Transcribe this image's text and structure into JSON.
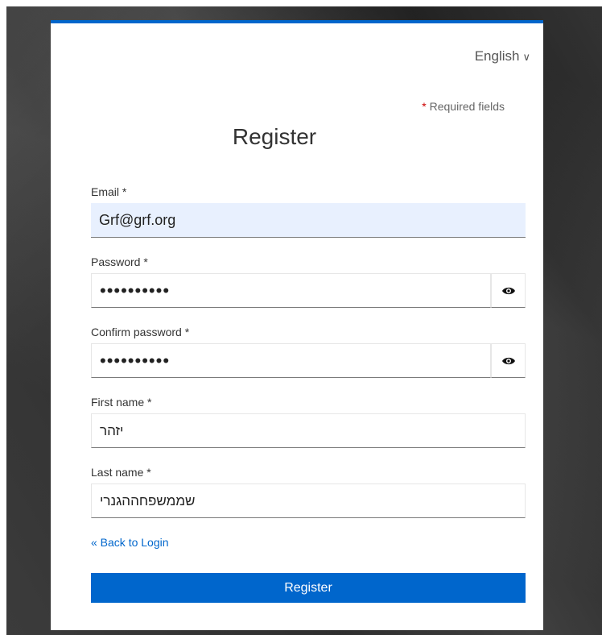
{
  "language": {
    "label": "English",
    "chevron": "∨"
  },
  "required_note": {
    "star": "*",
    "text": " Required fields"
  },
  "title": "Register",
  "fields": {
    "email": {
      "label": "Email *",
      "value": "Grf@grf.org"
    },
    "password": {
      "label": "Password *",
      "value": "••••••••••"
    },
    "confirm_password": {
      "label": "Confirm password *",
      "value": "••••••••••"
    },
    "first_name": {
      "label": "First name *",
      "value": "יזהר"
    },
    "last_name": {
      "label": "Last name *",
      "value": "שממשפחההגנרי"
    }
  },
  "back_link": "« Back to Login",
  "submit_label": "Register",
  "colors": {
    "accent": "#0066cc",
    "required": "#cc0000"
  },
  "icons": {
    "password_toggle": "eye-icon"
  }
}
